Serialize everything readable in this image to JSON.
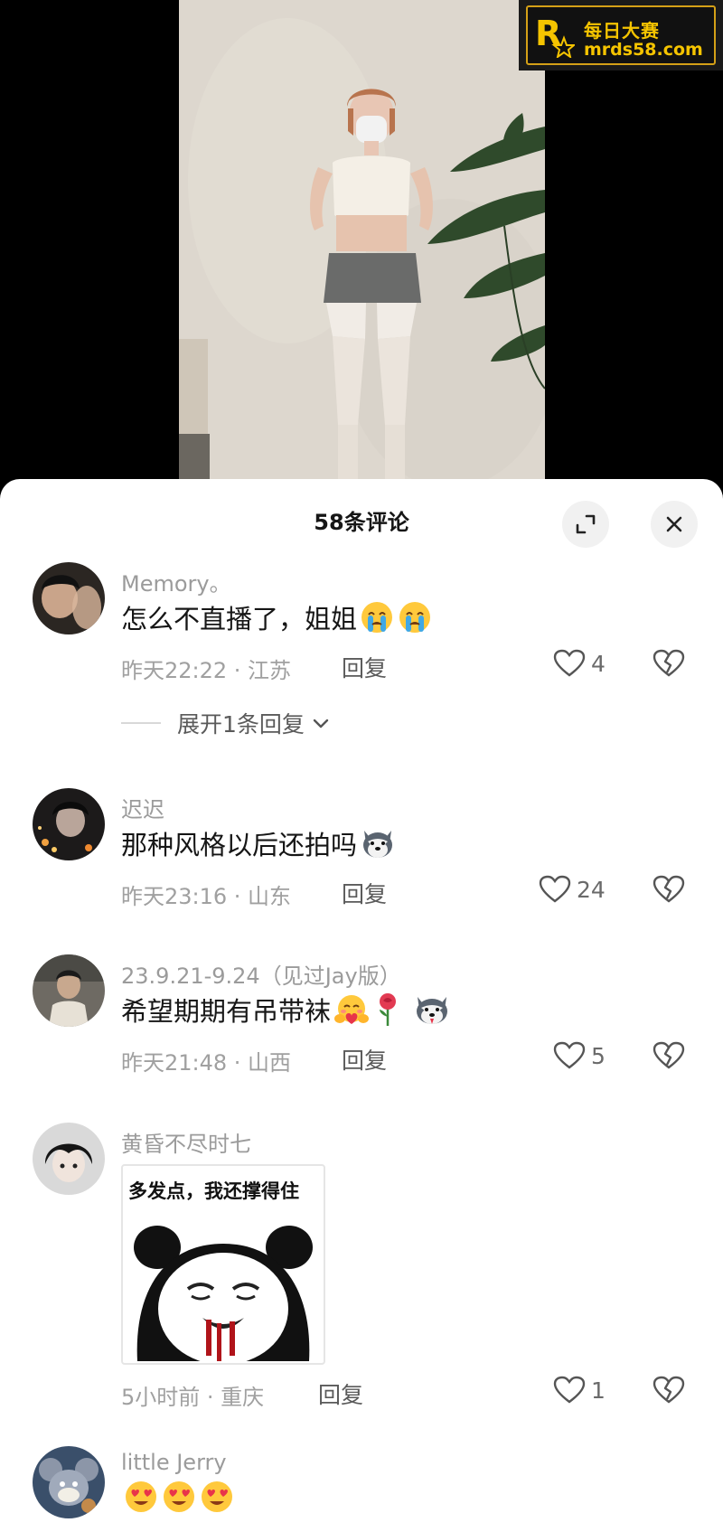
{
  "watermark": {
    "logo_letter": "R",
    "line1": "每日大赛",
    "line2": "mrds58.com"
  },
  "header": {
    "title": "58条评论",
    "expand_icon": "expand-icon",
    "close_icon": "close-icon"
  },
  "comments": [
    {
      "username": "Memory。",
      "text": "怎么不直播了，姐姐",
      "emojis": [
        "crying-face",
        "crying-face"
      ],
      "meta": "昨天22:22 · 江苏",
      "reply_label": "回复",
      "likes": "4",
      "expand_label": "展开1条回复"
    },
    {
      "username": "迟迟",
      "text": "那种风格以后还拍吗",
      "emojis": [
        "husky-dog"
      ],
      "meta": "昨天23:16 · 山东",
      "reply_label": "回复",
      "likes": "24"
    },
    {
      "username": "23.9.21-9.24（见过Jay版）",
      "text": "希望期期有吊带袜",
      "emojis": [
        "hugging-face",
        "rose",
        "husky-dog"
      ],
      "meta": "昨天21:48 · 山西",
      "reply_label": "回复",
      "likes": "5"
    },
    {
      "username": "黄昏不尽时七",
      "meme_caption": "多发点，我还撑得住",
      "meta": "5小时前 · 重庆",
      "reply_label": "回复",
      "likes": "1"
    },
    {
      "username": "little Jerry",
      "emojis": [
        "heart-eyes-face",
        "heart-eyes-face",
        "heart-eyes-face"
      ]
    }
  ],
  "colors": {
    "sheet_bg": "#ffffff",
    "username": "#9b9b9b",
    "text": "#161616",
    "watermark_gold": "#f5c400"
  }
}
